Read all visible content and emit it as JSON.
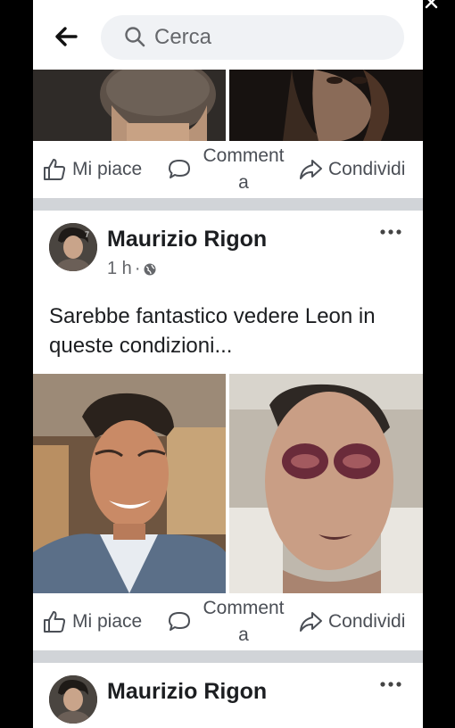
{
  "header": {
    "search_placeholder": "Cerca"
  },
  "actions": {
    "like_label": "Mi piace",
    "comment_label_line1": "Comment",
    "comment_label_line2": "a",
    "share_label": "Condividi"
  },
  "post": {
    "author": "Maurizio Rigon",
    "time": "1 h",
    "separator": "·",
    "text": "Sarebbe fantastico vedere Leon in queste condizioni..."
  },
  "next_post": {
    "author": "Maurizio Rigon"
  },
  "icons": {
    "back": "arrow-left-icon",
    "search": "search-icon",
    "like": "thumbs-up-icon",
    "comment": "comment-bubble-icon",
    "share": "share-arrow-icon",
    "privacy": "globe-icon",
    "more": "more-dots-icon",
    "close": "close-icon"
  },
  "colors": {
    "background": "#000000",
    "card": "#ffffff",
    "divider": "#d1d4d8",
    "secondary_text": "#65676b",
    "search_bg": "#f0f2f5"
  }
}
